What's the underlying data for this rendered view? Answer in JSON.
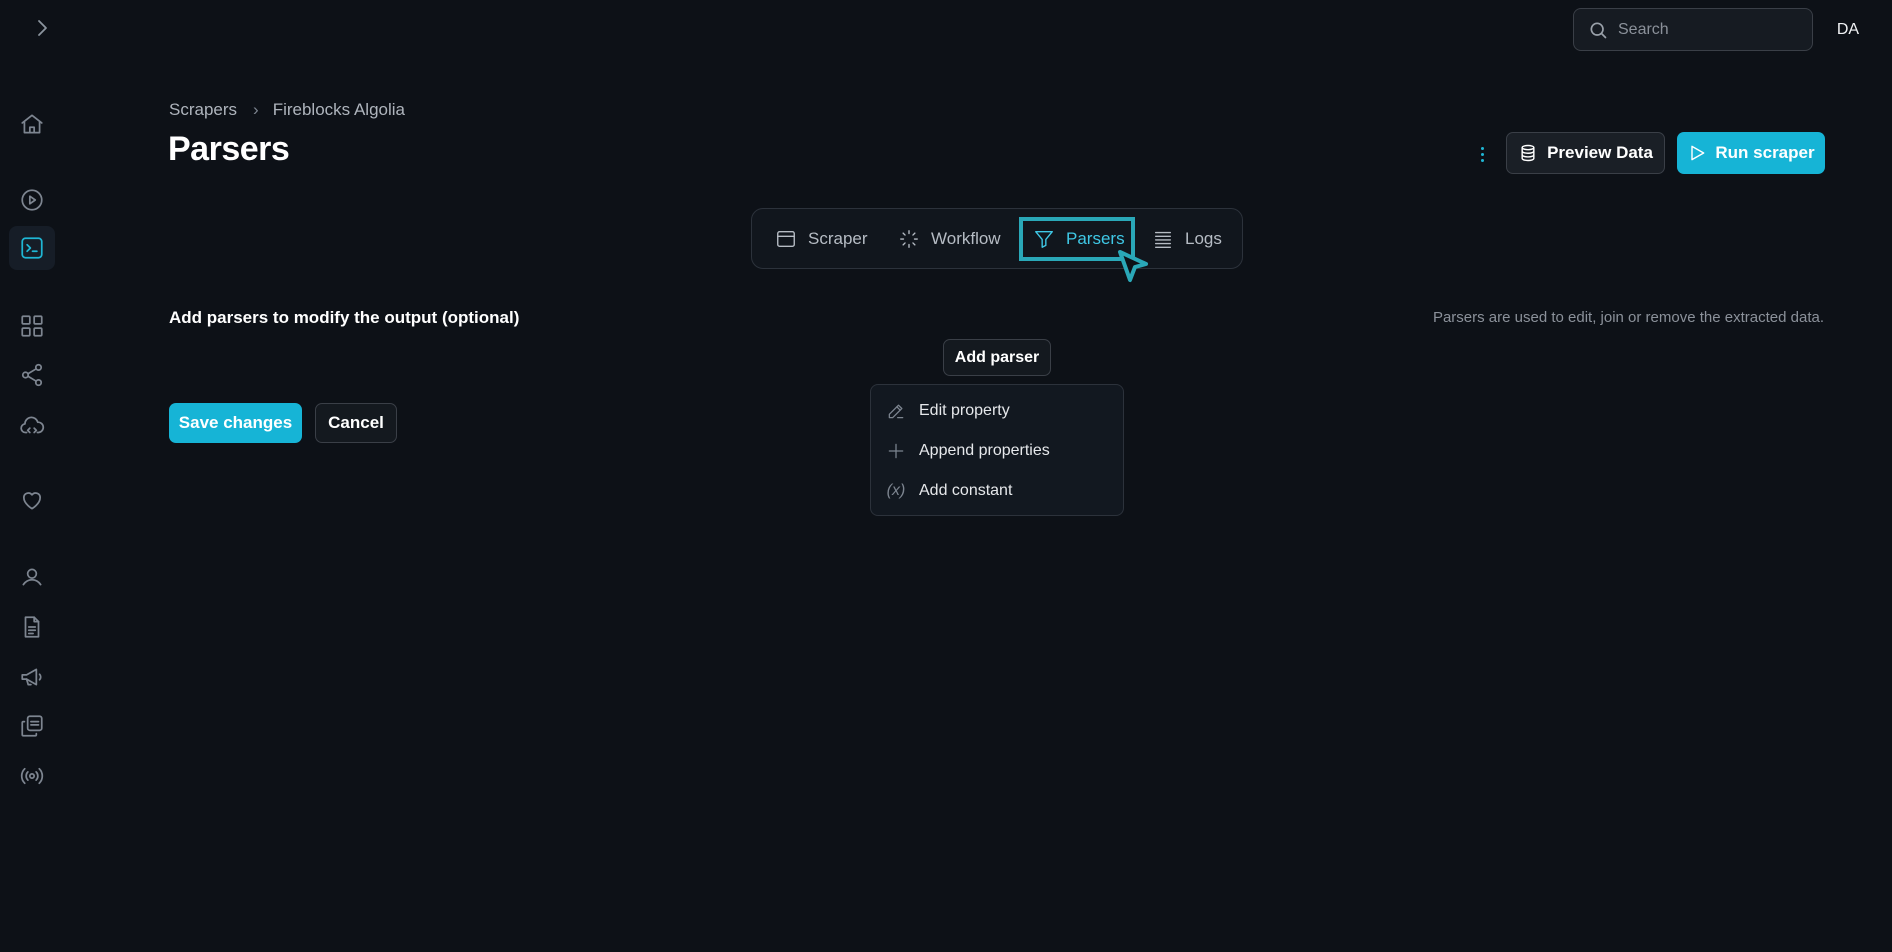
{
  "sidebar": {
    "expand_icon": "chevron-right-icon",
    "items": [
      {
        "name": "home",
        "icon": "home-icon",
        "active": false
      },
      {
        "name": "runs",
        "icon": "play-circle-icon",
        "active": false
      },
      {
        "name": "scrapers",
        "icon": "terminal-icon",
        "active": true
      },
      {
        "name": "apps",
        "icon": "grid-icon",
        "active": false
      },
      {
        "name": "integrations",
        "icon": "share-icon",
        "active": false
      },
      {
        "name": "cloud",
        "icon": "cloud-code-icon",
        "active": false
      },
      {
        "name": "favorites",
        "icon": "heart-icon",
        "active": false
      },
      {
        "name": "account",
        "icon": "user-icon",
        "active": false
      },
      {
        "name": "docs",
        "icon": "document-icon",
        "active": false
      },
      {
        "name": "announcements",
        "icon": "megaphone-icon",
        "active": false
      },
      {
        "name": "copies",
        "icon": "copy-icon",
        "active": false
      },
      {
        "name": "broadcast",
        "icon": "broadcast-icon",
        "active": false
      }
    ]
  },
  "topbar": {
    "search_placeholder": "Search",
    "avatar_initials": "DA"
  },
  "breadcrumb": {
    "items": [
      "Scrapers",
      "Fireblocks Algolia"
    ]
  },
  "page": {
    "title": "Parsers"
  },
  "actions": {
    "preview_label": "Preview Data",
    "run_label": "Run scraper"
  },
  "tabs": [
    {
      "label": "Scraper",
      "icon": "browser-window-icon",
      "active": false
    },
    {
      "label": "Workflow",
      "icon": "sparkle-click-icon",
      "active": false
    },
    {
      "label": "Parsers",
      "icon": "filter-icon",
      "active": true
    },
    {
      "label": "Logs",
      "icon": "list-icon",
      "active": false
    }
  ],
  "parsers_section": {
    "label": "Add parsers to modify the output (optional)",
    "hint": "Parsers are used to edit, join or remove the extracted data.",
    "add_button": "Add parser",
    "menu": [
      {
        "label": "Edit property",
        "icon": "edit-icon"
      },
      {
        "label": "Append properties",
        "icon": "plus-icon"
      },
      {
        "label": "Add constant",
        "icon": "variable-icon",
        "glyph": "(x)"
      }
    ]
  },
  "footer_buttons": {
    "save_label": "Save changes",
    "cancel_label": "Cancel"
  },
  "colors": {
    "background": "#0d1117",
    "accent": "#16b4d6",
    "highlight_border": "#2aa8b8"
  }
}
